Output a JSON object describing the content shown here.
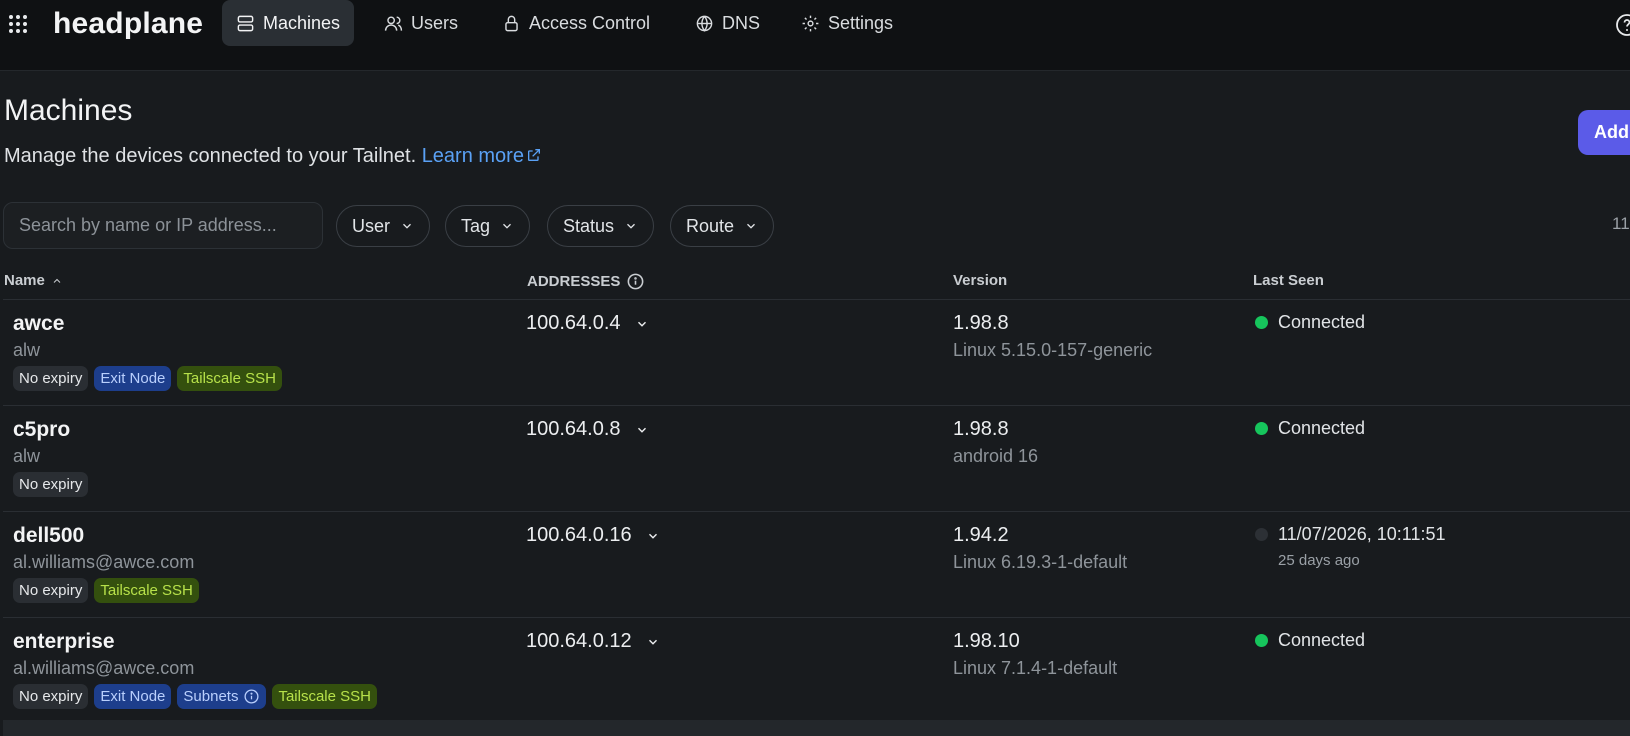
{
  "app": {
    "brand": "headplane",
    "nav": [
      {
        "label": "Machines",
        "icon": "server-icon",
        "active": true
      },
      {
        "label": "Users",
        "icon": "users-icon",
        "active": false
      },
      {
        "label": "Access Control",
        "icon": "lock-icon",
        "active": false
      },
      {
        "label": "DNS",
        "icon": "globe-icon",
        "active": false
      },
      {
        "label": "Settings",
        "icon": "gear-icon",
        "active": false
      }
    ]
  },
  "header": {
    "title": "Machines",
    "description": "Manage the devices connected to your Tailnet.",
    "learn_more": "Learn more",
    "add_button": "Add"
  },
  "filters": {
    "search_placeholder": "Search by name or IP address...",
    "user": "User",
    "tag": "Tag",
    "status": "Status",
    "route": "Route",
    "count": "11"
  },
  "table": {
    "columns": {
      "name": "Name",
      "addresses": "ADDRESSES",
      "version": "Version",
      "last_seen": "Last Seen"
    },
    "rows": [
      {
        "name": "awce",
        "user": "alw",
        "badges": [
          {
            "label": "No expiry",
            "kind": "gray"
          },
          {
            "label": "Exit Node",
            "kind": "blue"
          },
          {
            "label": "Tailscale SSH",
            "kind": "green"
          }
        ],
        "address": "100.64.0.4",
        "version": "1.98.8",
        "os": "Linux 5.15.0-157-generic",
        "status": "Connected",
        "online": true,
        "ago": ""
      },
      {
        "name": "c5pro",
        "user": "alw",
        "badges": [
          {
            "label": "No expiry",
            "kind": "gray"
          }
        ],
        "address": "100.64.0.8",
        "version": "1.98.8",
        "os": "android 16",
        "status": "Connected",
        "online": true,
        "ago": ""
      },
      {
        "name": "dell500",
        "user": "al.williams@awce.com",
        "badges": [
          {
            "label": "No expiry",
            "kind": "gray"
          },
          {
            "label": "Tailscale SSH",
            "kind": "green"
          }
        ],
        "address": "100.64.0.16",
        "version": "1.94.2",
        "os": "Linux 6.19.3-1-default",
        "status": "11/07/2026, 10:11:51",
        "online": false,
        "ago": "25 days ago"
      },
      {
        "name": "enterprise",
        "user": "al.williams@awce.com",
        "badges": [
          {
            "label": "No expiry",
            "kind": "gray"
          },
          {
            "label": "Exit Node",
            "kind": "blue"
          },
          {
            "label": "Subnets",
            "kind": "blue",
            "info": true
          },
          {
            "label": "Tailscale SSH",
            "kind": "green"
          }
        ],
        "address": "100.64.0.12",
        "version": "1.98.10",
        "os": "Linux 7.1.4-1-default",
        "status": "Connected",
        "online": true,
        "ago": ""
      }
    ]
  },
  "colors": {
    "background": "#181b1e",
    "topbar": "#0f1113",
    "accent": "#5b5be8",
    "link": "#5aa1f5",
    "online": "#16c55c"
  }
}
